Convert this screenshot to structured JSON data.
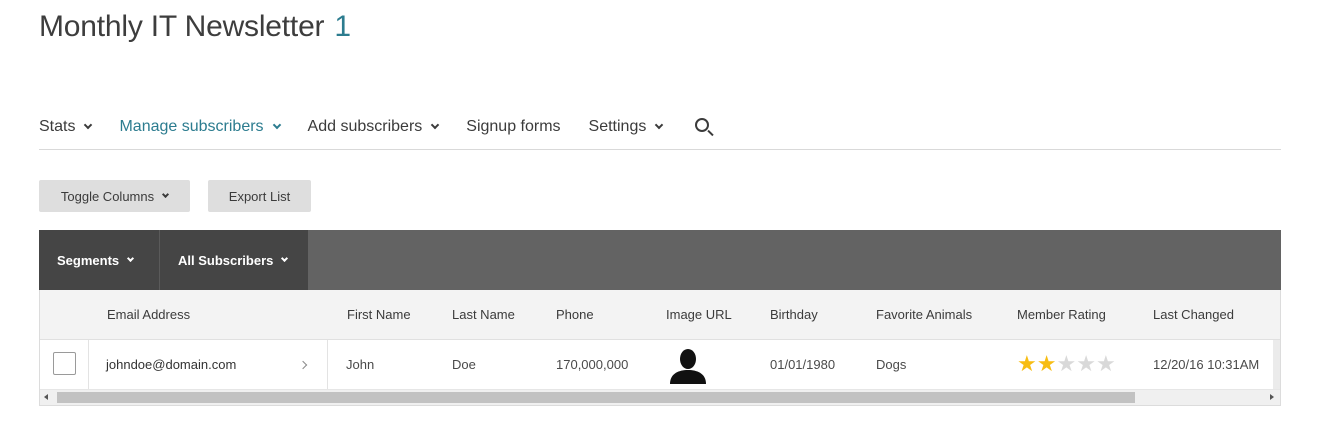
{
  "header": {
    "title": "Monthly IT Newsletter",
    "count": "1"
  },
  "nav": {
    "items": [
      {
        "label": "Stats",
        "dropdown": true,
        "active": false
      },
      {
        "label": "Manage subscribers",
        "dropdown": true,
        "active": true
      },
      {
        "label": "Add subscribers",
        "dropdown": true,
        "active": false
      },
      {
        "label": "Signup forms",
        "dropdown": false,
        "active": false
      },
      {
        "label": "Settings",
        "dropdown": true,
        "active": false
      }
    ],
    "search_icon": "search-icon"
  },
  "toolbar": {
    "toggle_columns_label": "Toggle Columns",
    "export_list_label": "Export List"
  },
  "segments_bar": {
    "segments_label": "Segments",
    "all_subscribers_label": "All Subscribers"
  },
  "table": {
    "columns": [
      "Email Address",
      "First Name",
      "Last Name",
      "Phone",
      "Image URL",
      "Birthday",
      "Favorite Animals",
      "Member Rating",
      "Last Changed"
    ],
    "rows": [
      {
        "email": "johndoe@domain.com",
        "first_name": "John",
        "last_name": "Doe",
        "phone": "170,000,000",
        "image_icon": "user-silhouette-icon",
        "birthday": "01/01/1980",
        "favorite_animals": "Dogs",
        "member_rating": 2,
        "member_rating_max": 5,
        "last_changed": "12/20/16 10:31AM"
      }
    ]
  },
  "colors": {
    "accent": "#2c7c8f",
    "star_on": "#f7bd13",
    "star_off": "#d9d9d9",
    "segment_bar": "#636363",
    "segment_button": "#454545"
  }
}
